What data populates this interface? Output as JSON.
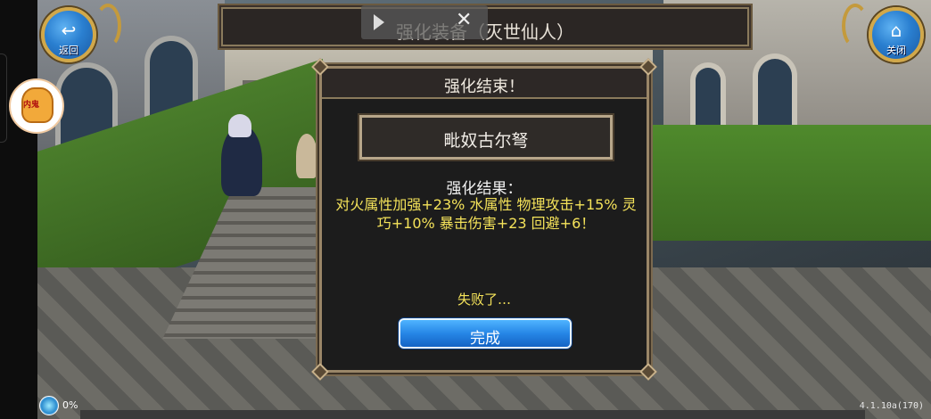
{
  "header": {
    "title": "强化装备（灭世仙人）",
    "back_label": "返回",
    "close_label": "关闭"
  },
  "video_overlay": {
    "play_icon": "play-icon",
    "close_icon": "close-icon"
  },
  "mascot": {
    "text": "内鬼"
  },
  "dialog": {
    "title": "强化结束！",
    "item_name": "毗奴古尔弩",
    "result_label": "强化结果：",
    "result_text": "对火属性加强+23% 水属性 物理攻击+15% 灵巧+10% 暴击伤害+23 回避+6！",
    "fail_text": "失败了…",
    "done_button": "完成"
  },
  "status": {
    "percent": "0%",
    "version": "4.1.10a(170)"
  },
  "colors": {
    "accent_yellow": "#f5e35a",
    "button_blue": "#2686e6",
    "frame_gold": "#9a8668"
  }
}
